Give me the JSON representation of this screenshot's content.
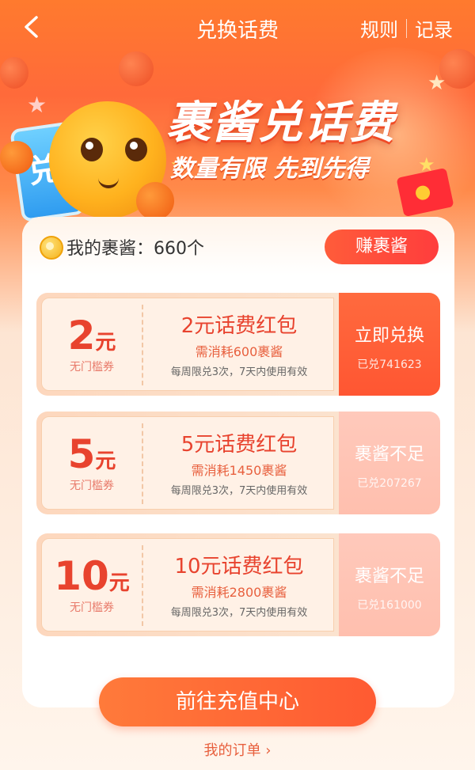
{
  "header": {
    "title": "兑换话费",
    "rules_label": "规则",
    "records_label": "记录"
  },
  "banner": {
    "title": "裹酱兑话费",
    "subtitle": "数量有限 先到先得",
    "phone_char": "兑"
  },
  "balance": {
    "text": "我的裹酱：660个",
    "earn_button": "赚裹酱"
  },
  "coupons": [
    {
      "amount": "2",
      "unit": "元",
      "tag": "无门槛券",
      "name": "2元话费红包",
      "cost": "需消耗600裹酱",
      "note": "每周限兑3次，7天内使用有效",
      "action": "立即兑换",
      "redeemed": "已兑741623",
      "state": "active"
    },
    {
      "amount": "5",
      "unit": "元",
      "tag": "无门槛券",
      "name": "5元话费红包",
      "cost": "需消耗1450裹酱",
      "note": "每周限兑3次，7天内使用有效",
      "action": "裹酱不足",
      "redeemed": "已兑207267",
      "state": "disabled"
    },
    {
      "amount": "10",
      "unit": "元",
      "tag": "无门槛券",
      "name": "10元话费红包",
      "cost": "需消耗2800裹酱",
      "note": "每周限兑3次，7天内使用有效",
      "action": "裹酱不足",
      "redeemed": "已兑161000",
      "state": "disabled"
    }
  ],
  "footer": {
    "recharge_button": "前往充值中心",
    "orders_link": "我的订单 ›"
  },
  "colors": {
    "accent": "#ff5a32",
    "price": "#e8432e",
    "disabled": "#ffc4b4"
  }
}
